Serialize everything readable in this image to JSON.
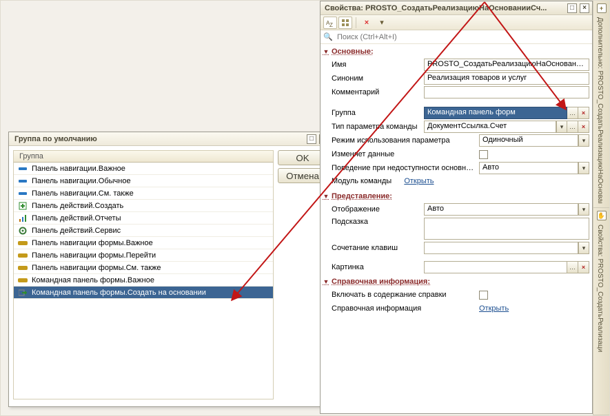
{
  "popup": {
    "title": "Группа по умолчанию",
    "list_header": "Группа",
    "ok_label": "OK",
    "cancel_label": "Отмена",
    "items": [
      {
        "icon": "nav-important",
        "icon_color": "#2a78c3",
        "label": "Панель навигации.Важное"
      },
      {
        "icon": "nav-normal",
        "icon_color": "#2a78c3",
        "label": "Панель навигации.Обычное"
      },
      {
        "icon": "nav-seealso",
        "icon_color": "#2a78c3",
        "label": "Панель навигации.См. также"
      },
      {
        "icon": "action-create",
        "icon_color": "#2e8b2e",
        "label": "Панель действий.Создать"
      },
      {
        "icon": "action-reports",
        "icon_color": "#c07000",
        "label": "Панель действий.Отчеты"
      },
      {
        "icon": "action-service",
        "icon_color": "#3a7a38",
        "label": "Панель действий.Сервис"
      },
      {
        "icon": "form-nav-important",
        "icon_color": "#c49a1a",
        "label": "Панель навигации формы.Важное"
      },
      {
        "icon": "form-nav-goto",
        "icon_color": "#c49a1a",
        "label": "Панель навигации формы.Перейти"
      },
      {
        "icon": "form-nav-seealso",
        "icon_color": "#c49a1a",
        "label": "Панель навигации формы.См. также"
      },
      {
        "icon": "form-cmd-important",
        "icon_color": "#c49a1a",
        "label": "Командная панель формы.Важное"
      },
      {
        "icon": "form-cmd-create",
        "icon_color": "#2e8b2e",
        "label": "Командная панель формы.Создать на основании",
        "selected": true
      }
    ]
  },
  "props": {
    "title": "Свойства: PROSTO_СоздатьРеализациюНаОснованииСч...",
    "search_placeholder": "Поиск (Ctrl+Alt+I)",
    "sections": {
      "main": {
        "header": "Основные:",
        "name_label": "Имя",
        "name_value": "PROSTO_СоздатьРеализациюНаОснованииСчета",
        "synonym_label": "Синоним",
        "synonym_value": "Реализация товаров и услуг",
        "comment_label": "Комментарий",
        "comment_value": "",
        "group_label": "Группа",
        "group_value": "Командная панель форм",
        "param_type_label": "Тип параметра команды",
        "param_type_value": "ДокументСсылка.Счет",
        "param_mode_label": "Режим использования параметра",
        "param_mode_value": "Одиночный",
        "changes_data_label": "Изменяет данные",
        "unavail_label": "Поведение при недоступности основного",
        "unavail_value": "Авто",
        "module_label": "Модуль команды",
        "module_link": "Открыть"
      },
      "presentation": {
        "header": "Представление:",
        "display_label": "Отображение",
        "display_value": "Авто",
        "hint_label": "Подсказка",
        "hint_value": "",
        "shortcut_label": "Сочетание клавиш",
        "shortcut_value": "",
        "picture_label": "Картинка",
        "picture_value": ""
      },
      "help": {
        "header": "Справочная информация:",
        "include_label": "Включать в содержание справки",
        "ref_label": "Справочная информация",
        "ref_link": "Открыть"
      }
    }
  },
  "side_tabs": {
    "tab1": "Дополнительно: PROSTO_СоздатьРеализациюНаОснованииСчета",
    "tab2": "Свойства: PROSTO_СоздатьРеализаци"
  }
}
